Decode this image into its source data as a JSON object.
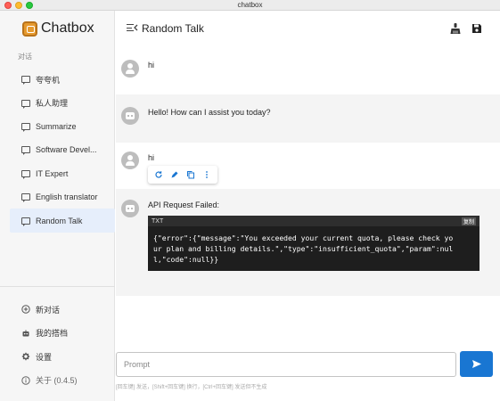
{
  "window": {
    "title": "chatbox"
  },
  "sidebar": {
    "brand": "Chatbox",
    "section_label": "对话",
    "conversations": [
      {
        "label": "夸夸机"
      },
      {
        "label": "私人助理"
      },
      {
        "label": "Summarize"
      },
      {
        "label": "Software Devel..."
      },
      {
        "label": "IT Expert"
      },
      {
        "label": "English translator"
      },
      {
        "label": "Random Talk"
      }
    ],
    "menu": {
      "new_chat": "新对话",
      "my_partner": "我的搭档",
      "settings": "设置",
      "about": "关于 (0.4.5)"
    }
  },
  "header": {
    "title": "Random Talk",
    "icons": [
      "clean-icon",
      "save-icon"
    ]
  },
  "messages": [
    {
      "role": "user",
      "text": "hi"
    },
    {
      "role": "assistant",
      "text": "Hello! How can I assist you today?"
    },
    {
      "role": "user",
      "text": "hi"
    },
    {
      "role": "assistant",
      "text": "API Request Failed:",
      "code": {
        "language": "TXT",
        "copy_label": "复制",
        "line1": "{\"error\":{\"message\":\"You exceeded your current quota, please check yo",
        "line2": "ur plan and billing details.\",\"type\":\"insufficient_quota\",\"param\":nul",
        "line3": "l,\"code\":null}}"
      }
    }
  ],
  "composer": {
    "placeholder": "Prompt",
    "hint": "[回车键] 发送，[Shift+回车键] 换行，[Ctrl+回车键] 发送但不生成"
  },
  "colors": {
    "accent": "#1976d2",
    "active_item_bg": "#e6eefb",
    "code_bg": "#1e1e1e"
  }
}
